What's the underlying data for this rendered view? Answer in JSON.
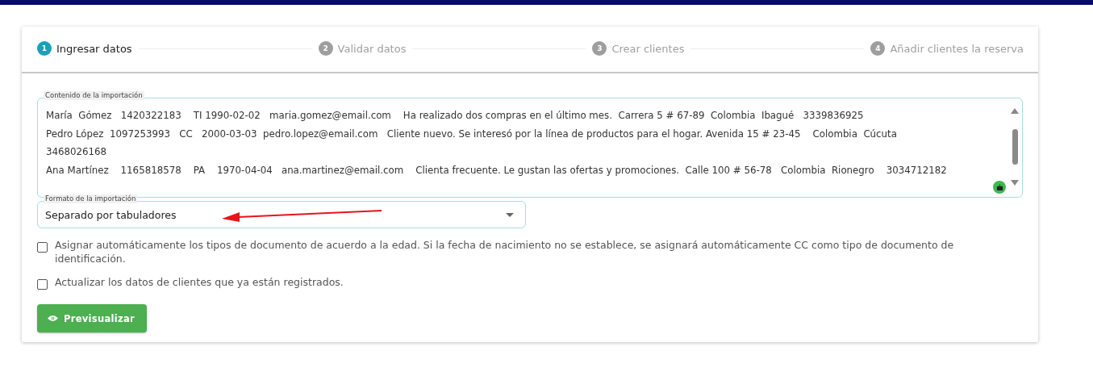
{
  "steps": [
    {
      "number": "1",
      "label": "Ingresar datos",
      "selected": true
    },
    {
      "number": "2",
      "label": "Validar datos",
      "selected": false
    },
    {
      "number": "3",
      "label": "Crear clientes",
      "selected": false
    },
    {
      "number": "4",
      "label": "Añadir clientes la reserva",
      "selected": false
    }
  ],
  "content_field": {
    "label": "Contenido de la importación",
    "lines": [
      "María  Gómez   1420322183    TI 1990-02-02   maria.gomez@email.com    Ha realizado dos compras en el último mes.  Carrera 5 # 67-89  Colombia  Ibagué   3339836925",
      "Pedro López  1097253993   CC   2000-03-03  pedro.lopez@email.com   Cliente nuevo. Se interesó por la línea de productos para el hogar. Avenida 15 # 23-45    Colombia  Cúcuta",
      "3468026168",
      "Ana Martínez    1165818578    PA    1970-04-04   ana.martinez@email.com    Clienta frecuente. Le gustan las ofertas y promociones.  Calle 100 # 56-78   Colombia  Rionegro    3034712182"
    ]
  },
  "format_field": {
    "label": "Formato de la importación",
    "value": "Separado por tabuladores"
  },
  "options": [
    {
      "label": "Asignar automáticamente los tipos de documento de acuerdo a la edad. Si la fecha de nacimiento no se establece, se asignará automáticamente CC como tipo de documento de identificación.",
      "checked": false
    },
    {
      "label": "Actualizar los datos de clientes que ya están registrados.",
      "checked": false
    }
  ],
  "preview_button": {
    "label": "Previsualizar"
  }
}
